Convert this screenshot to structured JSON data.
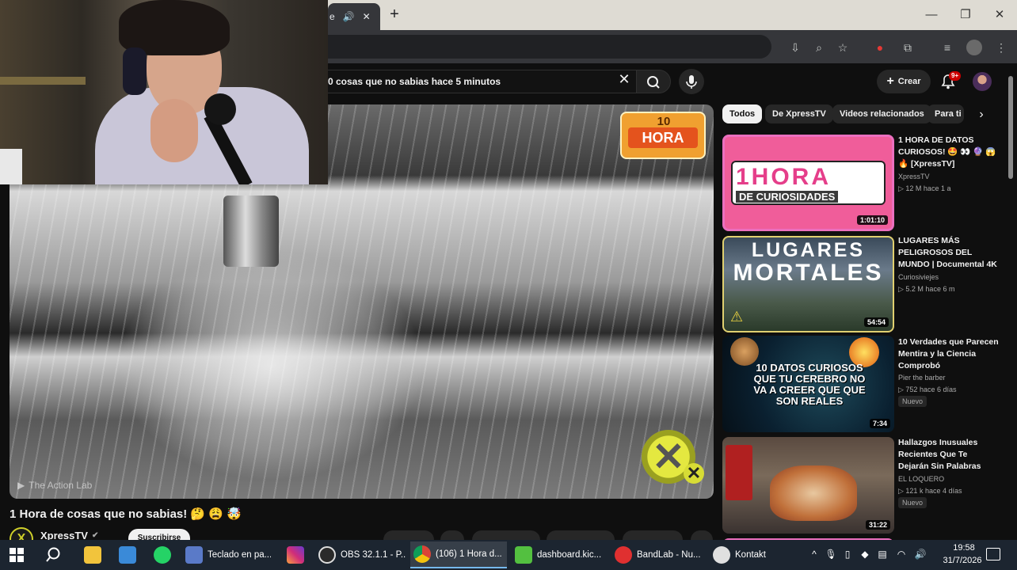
{
  "browser": {
    "tab_title_fragment": "e",
    "new_tab_glyph": "+",
    "window_controls": [
      "—",
      "❐",
      "✕"
    ]
  },
  "youtube": {
    "search_query": "0 cosas que no sabias hace 5 minutos",
    "create_label": "Crear",
    "notification_count": "9+"
  },
  "player": {
    "logo_number": "10",
    "logo_text": "HORA",
    "watermark": "The Action Lab"
  },
  "video": {
    "title": "1 Hora de cosas que no sabias! 🤔 😩 🤯",
    "channel": "XpressTV",
    "subscribe_label": "Suscribirse"
  },
  "chips": [
    "Todos",
    "De XpressTV",
    "Videos relacionados",
    "Para ti"
  ],
  "related": [
    {
      "title": "1 HORA DE DATOS CURIOSOS! 🤩 👀 🔮 😱 🔥 [XpressTV]",
      "channel": "XpressTV",
      "meta": "▷ 12 M  hace 1 a",
      "duration": "1:01:10",
      "thumb_big": "1HORA",
      "thumb_small": "DE CURIOSIDADES"
    },
    {
      "title": "LUGARES MÁS PELIGROSOS DEL MUNDO | Documental 4K",
      "channel": "Curiosiviejes",
      "meta": "▷ 5.2 M  hace 6 m",
      "duration": "54:54",
      "thumb_line1": "LUGARES",
      "thumb_line2": "MORTALES"
    },
    {
      "title": "10 Verdades que Parecen Mentira y la Ciencia Comprobó",
      "channel": "Pier the barber",
      "meta": "▷ 752  hace 6 días",
      "duration": "7:34",
      "badge": "Nuevo",
      "thumb_text": "10 DATOS CURIOSOS QUE TU CEREBRO NO VA A CREER QUE QUE SON REALES"
    },
    {
      "title": "Hallazgos Inusuales Recientes Que Te Dejarán Sin Palabras",
      "channel": "EL LOQUERO",
      "meta": "▷ 121 k  hace 4 días",
      "duration": "31:22",
      "badge": "Nuevo"
    }
  ],
  "taskbar": {
    "apps": [
      {
        "label": "Teclado en pa...",
        "color": "#5a7ac8"
      },
      {
        "label": "OBS 32.1.1 - P...",
        "color": "#2a2a2a"
      },
      {
        "label": "(106) 1 Hora d...",
        "color": "#e8e8e8"
      },
      {
        "label": "dashboard.kic...",
        "color": "#53c040"
      },
      {
        "label": "BandLab - Nu...",
        "color": "#e03030"
      },
      {
        "label": "Kontakt",
        "color": "#e0e0e0"
      }
    ],
    "time": "19:58",
    "date": "31/7/2026"
  }
}
